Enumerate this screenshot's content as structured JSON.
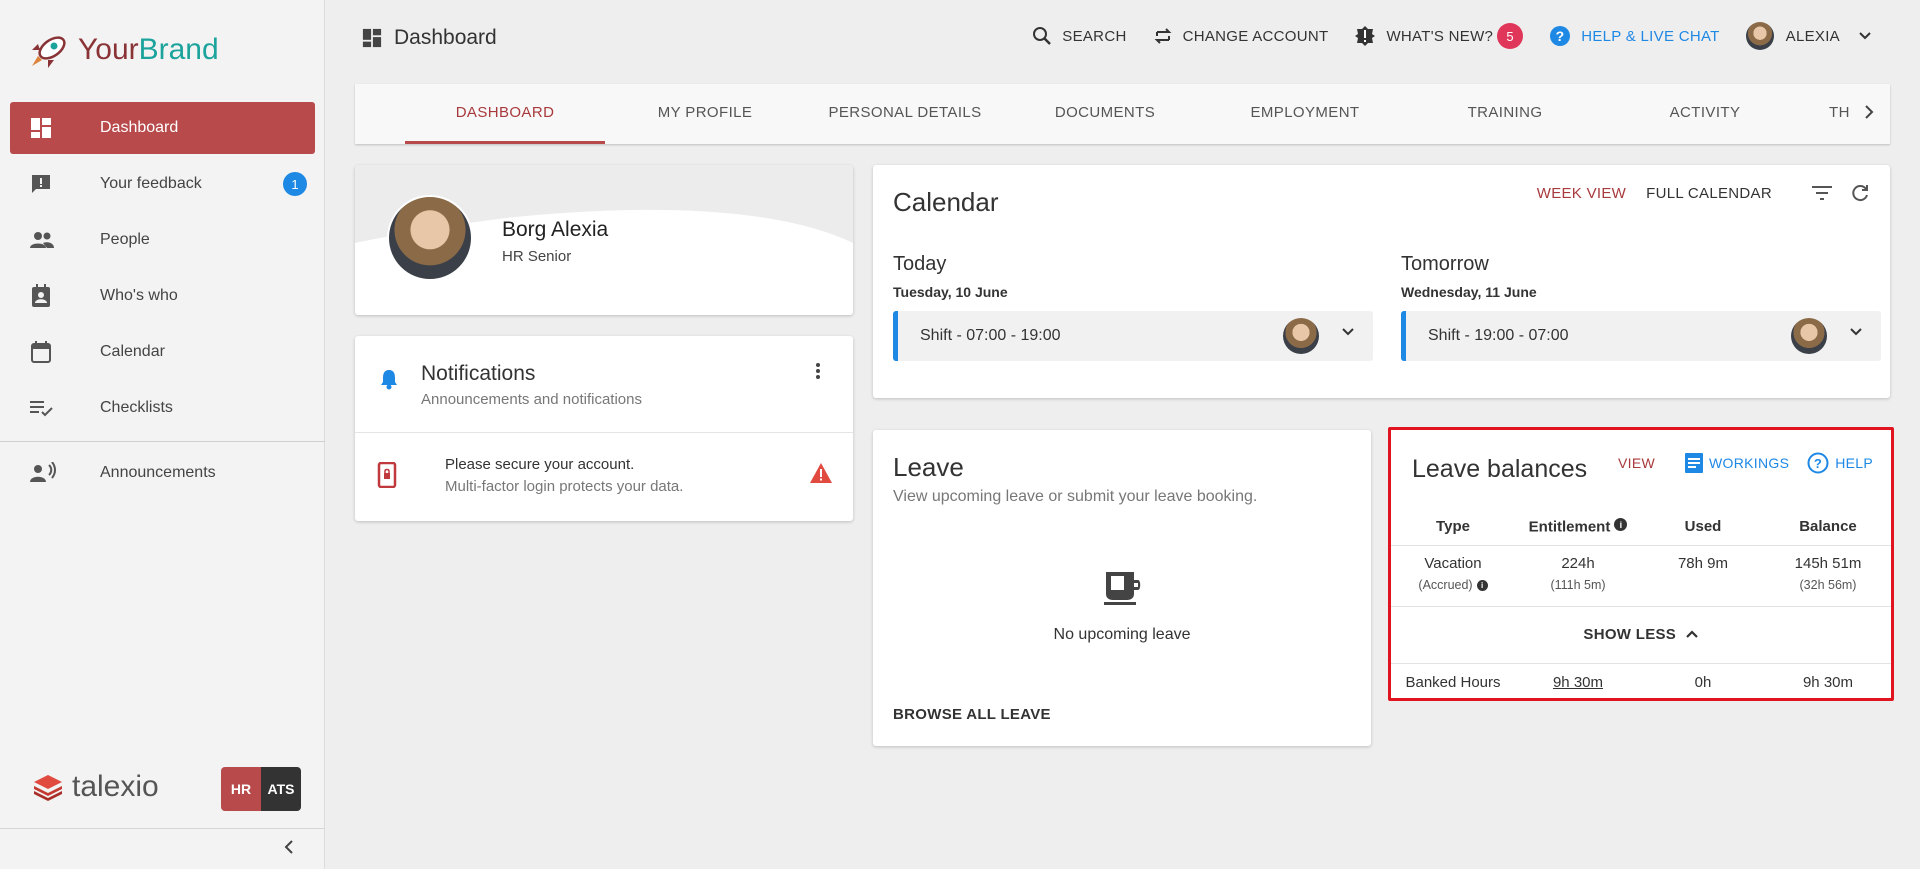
{
  "brand": {
    "part1": "Your",
    "part2": "Brand"
  },
  "sidebar": {
    "items": [
      {
        "label": "Dashboard",
        "icon": "dashboard-icon"
      },
      {
        "label": "Your feedback",
        "icon": "feedback-icon",
        "count": "1"
      },
      {
        "label": "People",
        "icon": "people-icon"
      },
      {
        "label": "Who's who",
        "icon": "contact-card-icon"
      },
      {
        "label": "Calendar",
        "icon": "calendar-icon"
      },
      {
        "label": "Checklists",
        "icon": "checklist-icon"
      },
      {
        "label": "Announcements",
        "icon": "megaphone-person-icon"
      }
    ],
    "footer_logo": "talexio",
    "switch": {
      "hr": "HR",
      "ats": "ATS"
    }
  },
  "header": {
    "title": "Dashboard",
    "search": "SEARCH",
    "change_account": "CHANGE ACCOUNT",
    "whats_new": "WHAT'S NEW?",
    "whats_new_count": "5",
    "help": "HELP & LIVE CHAT",
    "user": "ALEXIA"
  },
  "tabs": [
    "DASHBOARD",
    "MY PROFILE",
    "PERSONAL DETAILS",
    "DOCUMENTS",
    "EMPLOYMENT",
    "TRAINING",
    "ACTIVITY",
    "TH"
  ],
  "profile": {
    "name": "Borg Alexia",
    "role": "HR Senior"
  },
  "notifications": {
    "title": "Notifications",
    "subtitle": "Announcements and notifications",
    "item_title": "Please secure your account.",
    "item_body": "Multi-factor login protects your data."
  },
  "calendar": {
    "title": "Calendar",
    "week_view": "WEEK VIEW",
    "full_calendar": "FULL CALENDAR",
    "today": {
      "label": "Today",
      "date": "Tuesday, 10 June",
      "shift": "Shift - 07:00 - 19:00"
    },
    "tomorrow": {
      "label": "Tomorrow",
      "date": "Wednesday, 11 June",
      "shift": "Shift - 19:00 - 07:00"
    }
  },
  "leave": {
    "title": "Leave",
    "subtitle": "View upcoming leave or submit your leave booking.",
    "empty": "No upcoming leave",
    "browse": "BROWSE ALL LEAVE"
  },
  "balances": {
    "title": "Leave balances",
    "view": "VIEW",
    "workings": "WORKINGS",
    "help": "HELP",
    "headers": {
      "type": "Type",
      "entitlement": "Entitlement",
      "used": "Used",
      "balance": "Balance"
    },
    "vacation": {
      "type": "Vacation",
      "type_sub": "(Accrued)",
      "entitlement": "224h",
      "entitlement_sub": "(111h 5m)",
      "used": "78h 9m",
      "balance": "145h 51m",
      "balance_sub": "(32h 56m)"
    },
    "show_less": "SHOW LESS",
    "banked": {
      "type": "Banked Hours",
      "entitlement": "9h 30m",
      "used": "0h",
      "balance": "9h 30m"
    }
  },
  "colors": {
    "accent": "#b84a4c",
    "link": "#1e88e5",
    "highlight": "#e0141e",
    "badge": "#e0365a"
  }
}
